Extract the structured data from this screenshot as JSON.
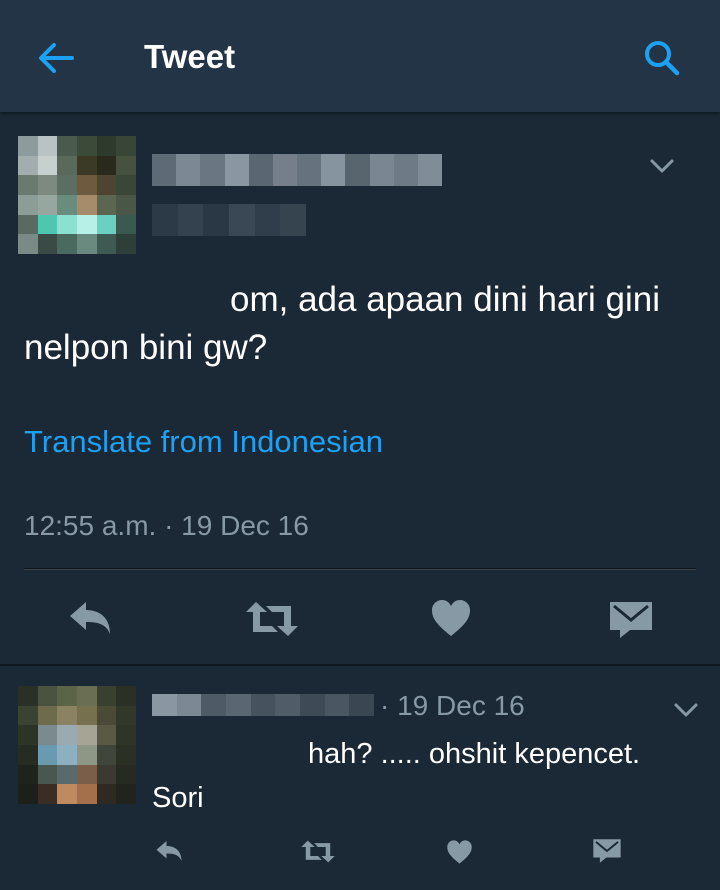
{
  "header": {
    "title": "Tweet"
  },
  "tweet": {
    "text_rest": "om, ada apaan dini hari gini nelpon bini gw?",
    "translate_label": "Translate from Indonesian",
    "timestamp": "12:55 a.m. · 19 Dec 16"
  },
  "reply": {
    "date": "· 19 Dec 16",
    "text_rest": "hah? ..... ohshit kepencet. Sori"
  },
  "colors": {
    "background": "#1b2836",
    "topbar": "#243447",
    "accent": "#1da1f2",
    "muted": "#8899a6",
    "icon": "#8899a6"
  },
  "icons": [
    "back-arrow-icon",
    "search-icon",
    "chevron-down-icon",
    "reply-icon",
    "retweet-icon",
    "like-icon",
    "direct-message-icon"
  ]
}
